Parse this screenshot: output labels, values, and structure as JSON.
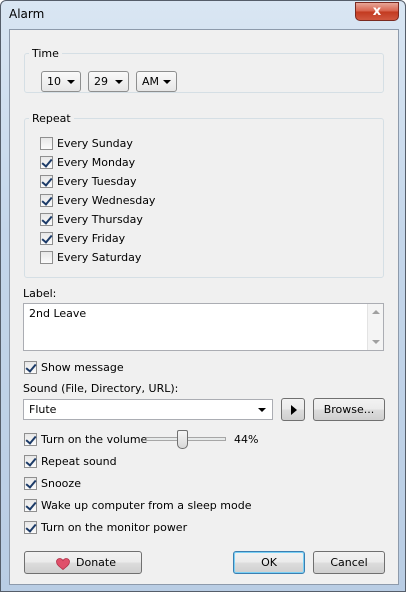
{
  "window": {
    "title": "Alarm",
    "close_label": "x"
  },
  "time": {
    "group_label": "Time",
    "hour": "10",
    "minute": "29",
    "ampm": "AM"
  },
  "repeat": {
    "group_label": "Repeat",
    "days": [
      {
        "label": "Every Sunday",
        "checked": false
      },
      {
        "label": "Every Monday",
        "checked": true
      },
      {
        "label": "Every Tuesday",
        "checked": true
      },
      {
        "label": "Every Wednesday",
        "checked": true
      },
      {
        "label": "Every Thursday",
        "checked": true
      },
      {
        "label": "Every Friday",
        "checked": true
      },
      {
        "label": "Every Saturday",
        "checked": false
      }
    ]
  },
  "label": {
    "caption": "Label:",
    "value": "2nd Leave"
  },
  "show_message": {
    "label": "Show message",
    "checked": true
  },
  "sound": {
    "caption": "Sound (File, Directory, URL):",
    "value": "Flute",
    "browse_label": "Browse..."
  },
  "volume": {
    "label": "Turn on the volume",
    "checked": true,
    "percent_text": "44%",
    "level": 0.44
  },
  "options": {
    "repeat_sound": {
      "label": "Repeat sound",
      "checked": true
    },
    "snooze": {
      "label": "Snooze",
      "checked": true
    },
    "wake_up": {
      "label": "Wake up computer from a sleep mode",
      "checked": true
    },
    "monitor_power": {
      "label": "Turn on the monitor power",
      "checked": true
    }
  },
  "buttons": {
    "donate": "Donate",
    "ok": "OK",
    "cancel": "Cancel"
  },
  "colors": {
    "heart": "#e0506a",
    "default_button_border": "#3c7fb1"
  }
}
